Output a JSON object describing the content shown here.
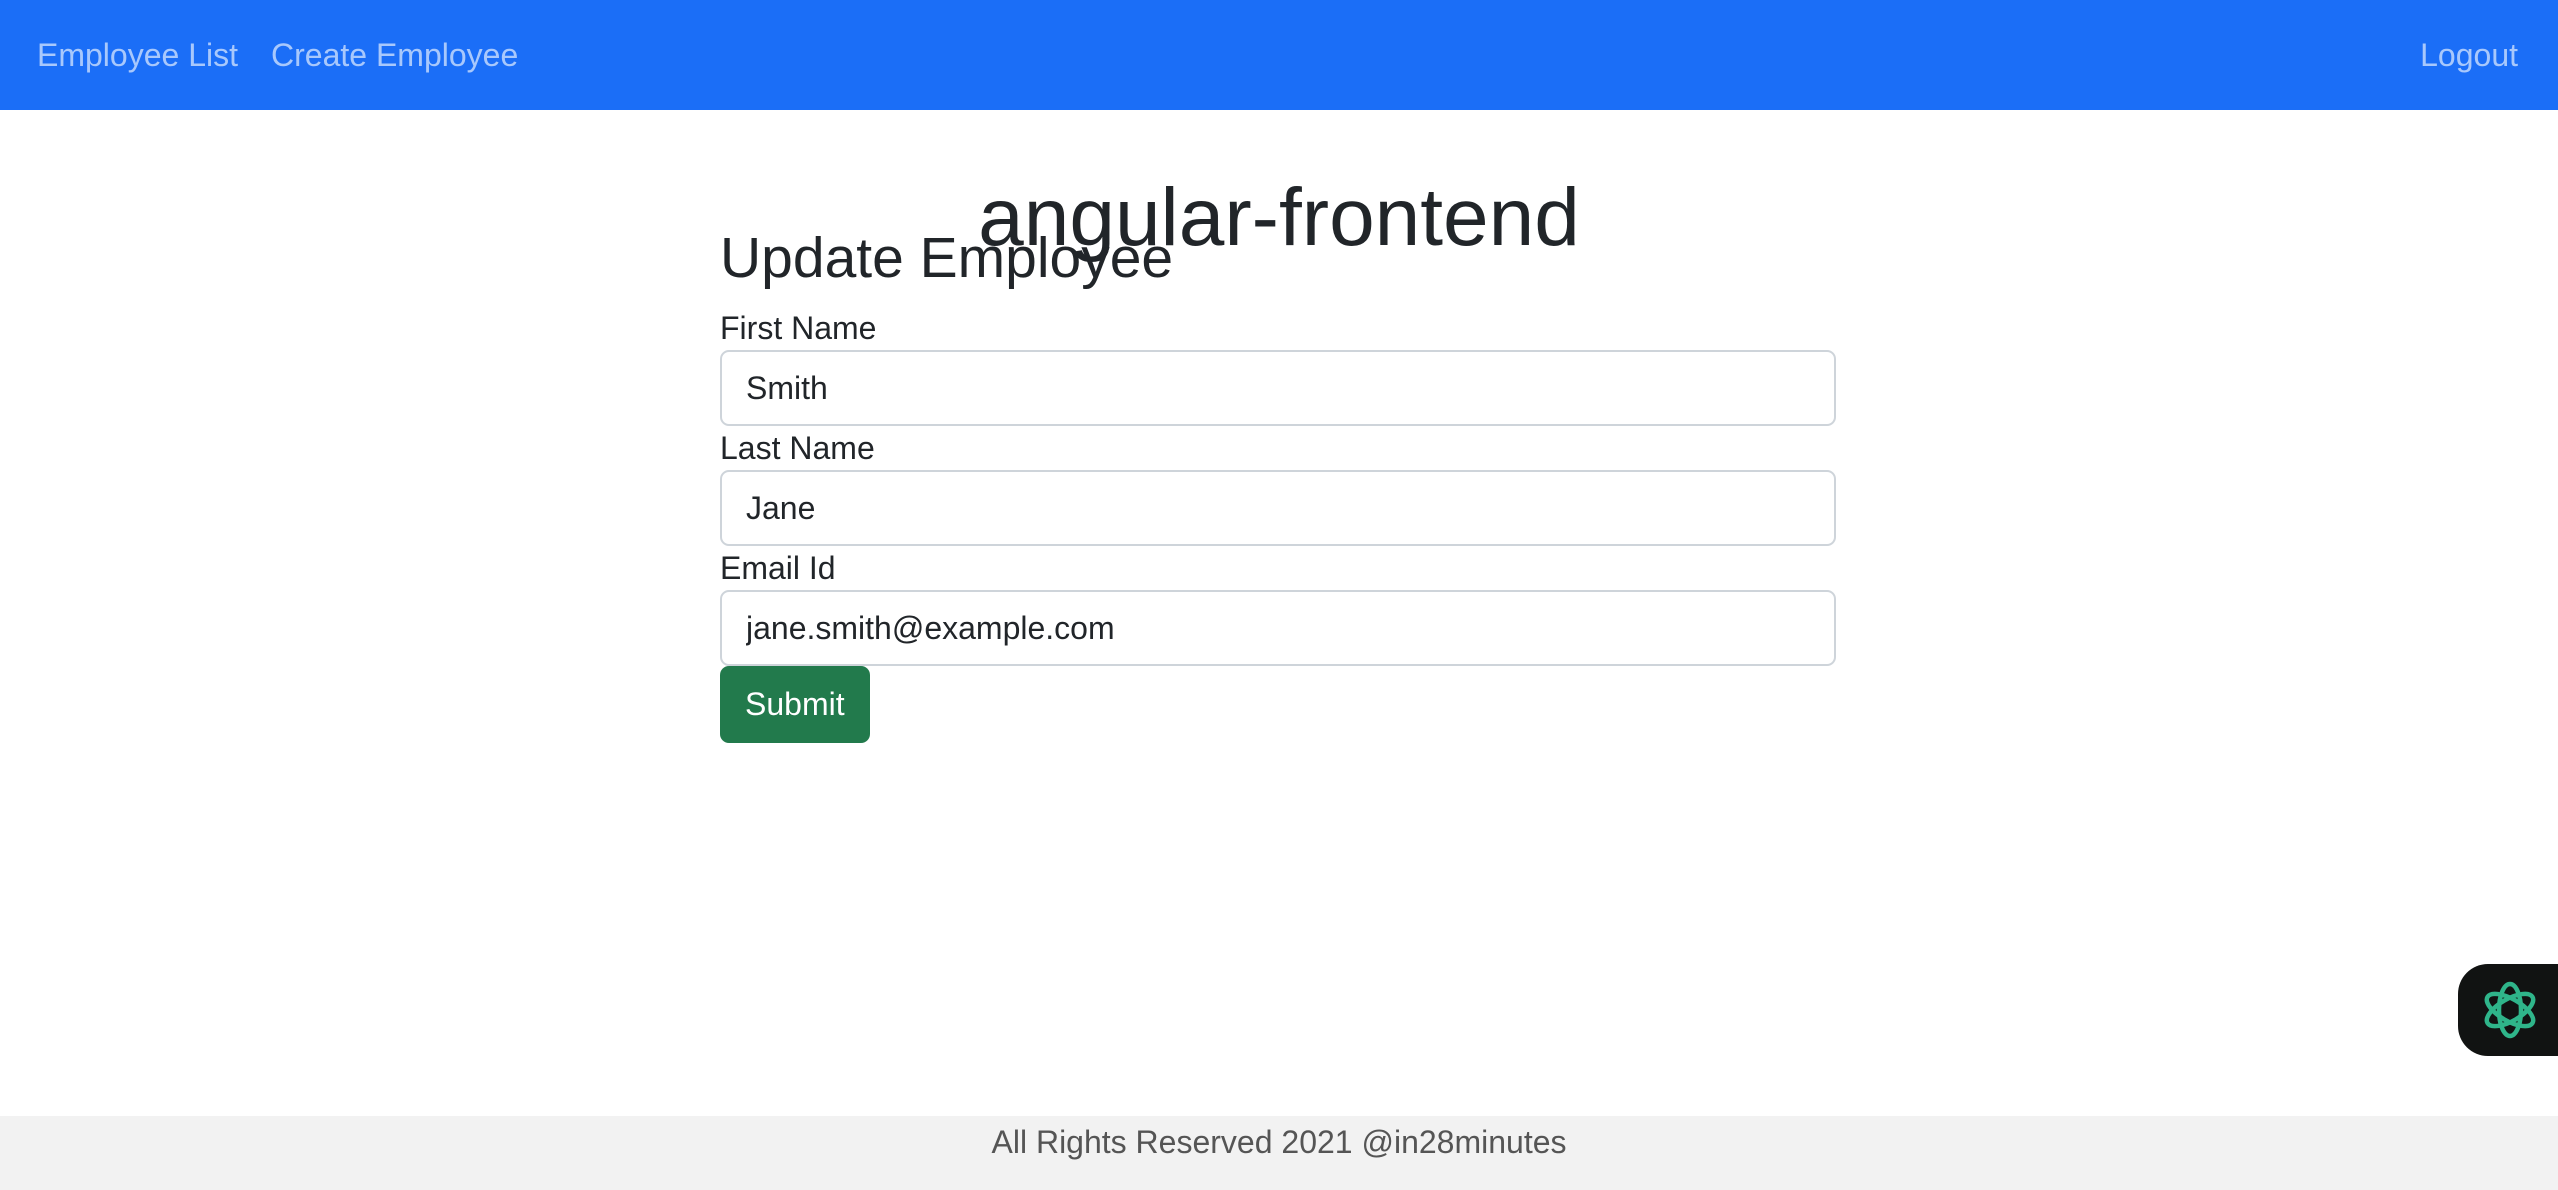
{
  "nav": {
    "employee_list": "Employee List",
    "create_employee": "Create Employee",
    "logout": "Logout",
    "background_color": "#1b6ef7"
  },
  "app_title": "angular-frontend",
  "form": {
    "heading": "Update Employee",
    "first_name": {
      "label": "First Name",
      "value": "Smith"
    },
    "last_name": {
      "label": "Last Name",
      "value": "Jane"
    },
    "email": {
      "label": "Email Id",
      "value": "jane.smith@example.com"
    },
    "submit_label": "Submit",
    "submit_color": "#227a4c"
  },
  "assistant": {
    "icon": "assistant-knot-icon"
  },
  "footer": {
    "text": "All Rights Reserved 2021 @in28minutes"
  }
}
